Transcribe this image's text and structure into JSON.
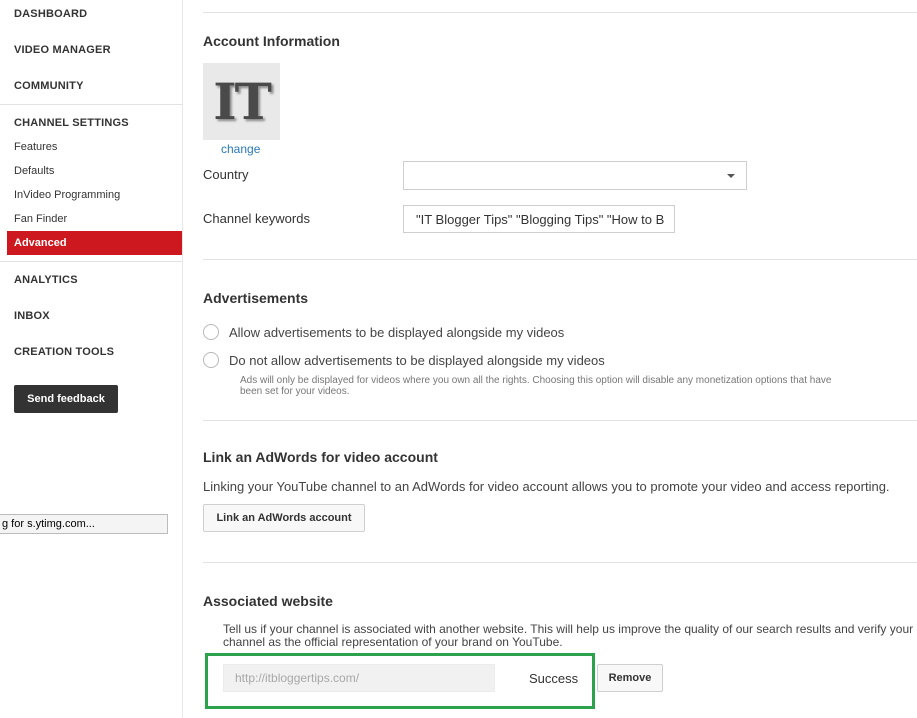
{
  "sidebar": {
    "dashboard": "DASHBOARD",
    "video_manager": "VIDEO MANAGER",
    "community": "COMMUNITY",
    "channel_settings": "CHANNEL SETTINGS",
    "features": "Features",
    "defaults": "Defaults",
    "invideo": "InVideo Programming",
    "fan_finder": "Fan Finder",
    "advanced": "Advanced",
    "analytics": "ANALYTICS",
    "inbox": "INBOX",
    "creation_tools": "CREATION TOOLS",
    "feedback_button": "Send feedback"
  },
  "status_bar": "g for s.ytimg.com...",
  "account": {
    "title": "Account Information",
    "avatar_text": "IT",
    "change_link": "change",
    "country_label": "Country",
    "country_value": "",
    "keywords_label": "Channel keywords",
    "keywords_value": "\"IT Blogger Tips\" \"Blogging Tips\" \"How to B"
  },
  "ads": {
    "title": "Advertisements",
    "option_allow": "Allow advertisements to be displayed alongside my videos",
    "option_disallow": "Do not allow advertisements to be displayed alongside my videos",
    "note": "Ads will only be displayed for videos where you own all the rights. Choosing this option will disable any monetization options that have been set for your videos."
  },
  "adwords": {
    "title": "Link an AdWords for video account",
    "description": "Linking your YouTube channel to an AdWords for video account allows you to promote your video and access reporting.",
    "button": "Link an AdWords account"
  },
  "website": {
    "title": "Associated website",
    "description": "Tell us if your channel is associated with another website. This will help us improve the quality of our search results and verify your channel as the official representation of your brand on YouTube.",
    "url_value": "http://itbloggertips.com/",
    "status": "Success",
    "remove_button": "Remove"
  },
  "colors": {
    "active_nav": "#cc181e",
    "highlight_box": "#2ca24d",
    "link": "#2a7ab7"
  }
}
